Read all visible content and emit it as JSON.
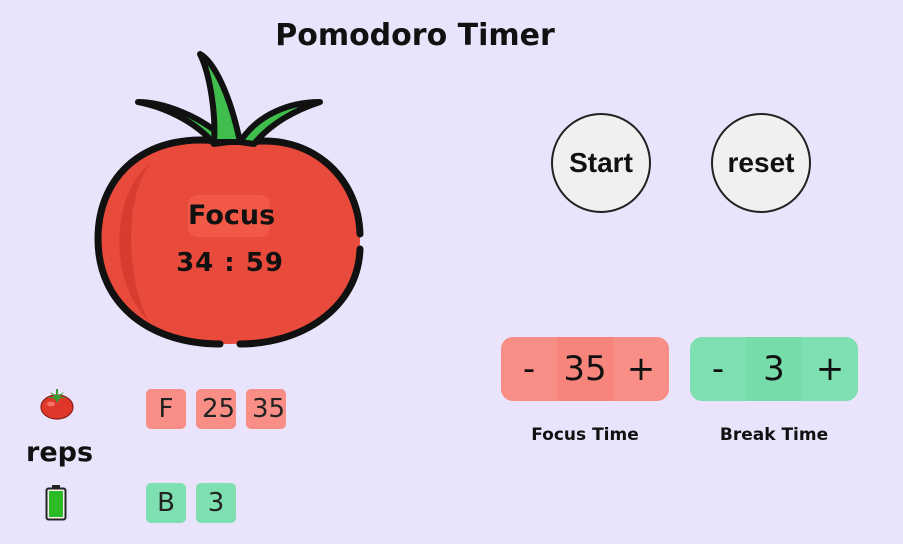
{
  "app": {
    "title": "Pomodoro Timer"
  },
  "timer": {
    "mode": "Focus",
    "time": "34 : 59"
  },
  "controls": {
    "start_label": "Start",
    "reset_label": "reset"
  },
  "focus_stepper": {
    "minus": "-",
    "value": "35",
    "plus": "+",
    "caption": "Focus Time"
  },
  "break_stepper": {
    "minus": "-",
    "value": "3",
    "plus": "+",
    "caption": "Break Time"
  },
  "reps": {
    "label": "reps",
    "focus_icon": "tomato-icon",
    "break_icon": "battery-icon",
    "focus_chips": [
      "F",
      "25",
      "35"
    ],
    "break_chips": [
      "B",
      "3"
    ]
  },
  "colors": {
    "background": "#e9e4fb",
    "tomato": "#e84a3b",
    "focus_accent": "#f88e85",
    "break_accent": "#7ee0b0"
  }
}
